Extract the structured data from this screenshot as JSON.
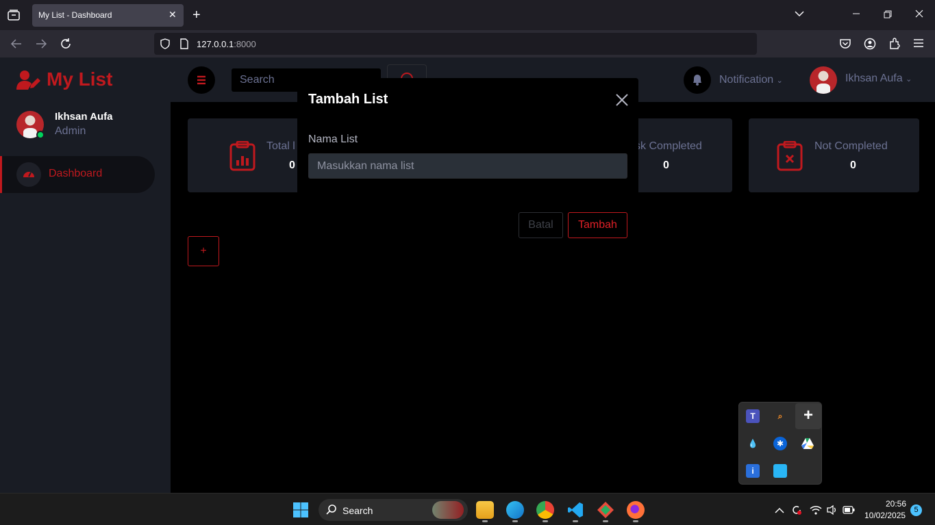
{
  "browser": {
    "tab_title": "My List - Dashboard",
    "url_host": "127.0.0.1",
    "url_port": ":8000"
  },
  "sidebar": {
    "brand": "My List",
    "user_name": "Ikhsan Aufa",
    "user_role": "Admin",
    "items": [
      {
        "label": "Dashboard",
        "active": true
      }
    ]
  },
  "topnav": {
    "search_placeholder": "Search",
    "notification_label": "Notification",
    "user_name": "Ikhsan Aufa"
  },
  "cards": [
    {
      "title": "Total List",
      "value": "0"
    },
    {
      "title": "Task Completed",
      "value": "0"
    },
    {
      "title": "Not Completed",
      "value": "0"
    }
  ],
  "cards_visible": {
    "card1_title": "Total l",
    "card2_title": "sk Completed"
  },
  "add_button_label": "+",
  "modal": {
    "title": "Tambah List",
    "field_label": "Nama List",
    "field_placeholder": "Masukkan nama list",
    "field_value": "",
    "cancel_label": "Batal",
    "submit_label": "Tambah"
  },
  "taskbar": {
    "search_label": "Search",
    "time": "20:56",
    "date": "10/02/2025",
    "notification_count": "5"
  },
  "colors": {
    "accent": "#c0191e",
    "sidebar_bg": "#191c24",
    "muted_text": "#6c7293"
  }
}
